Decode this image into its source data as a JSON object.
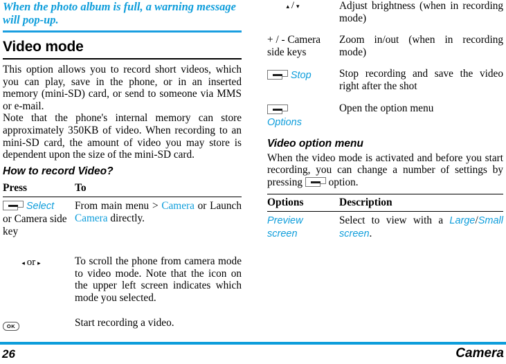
{
  "left_column": {
    "callout_note": "When the photo album is full, a warning message will pop-up.",
    "section_title": "Video mode",
    "paragraphs": [
      "This option allows you to record short videos, which you can play, save in the phone, or in an inserted memory (mini-SD) card, or send to someone via MMS or e-mail.",
      "Note that the phone's internal memory can store approximately 350KB of video. When recording to an mini-SD card, the amount of video you may store is dependent upon the size of the mini-SD card."
    ],
    "subhead": "How to record Video?",
    "table": {
      "headers": [
        "Press",
        "To"
      ],
      "rows": [
        {
          "press_icon": "softkey-icon",
          "press_icon_label": "Select",
          "press_text": "or Camera side key",
          "to_parts": [
            {
              "text": "From main menu > ",
              "style": "plain"
            },
            {
              "text": "Camera",
              "style": "blue"
            },
            {
              "text": " or Launch ",
              "style": "plain"
            },
            {
              "text": "Camera",
              "style": "blue"
            },
            {
              "text": " directly.",
              "style": "plain"
            }
          ]
        },
        {
          "press_icon": "left-right-arrows-icon",
          "press_left_arrow": "◂",
          "press_or": "or",
          "press_right_arrow": "▸",
          "to_parts": [
            {
              "text": "To scroll the phone from camera mode to video mode. Note that the icon on the upper left screen indicates which mode you selected.",
              "style": "plain"
            }
          ]
        },
        {
          "press_icon": "ok-key-icon",
          "press_icon_label": "OK",
          "to_parts": [
            {
              "text": "Start recording a video.",
              "style": "plain"
            }
          ]
        }
      ]
    }
  },
  "right_column": {
    "table_continued": {
      "rows": [
        {
          "press_icon": "up-down-arrows-icon",
          "press_up_arrow": "▴",
          "press_sep": "/",
          "press_down_arrow": "▾",
          "to_text": "Adjust brightness (when in recording mode)"
        },
        {
          "press_text": "+ / - Camera side keys",
          "to_text": "Zoom in/out (when in recording mode)"
        },
        {
          "press_icon": "softkey-icon",
          "press_icon_label": "Stop",
          "to_text": "Stop recording and save the video right after the shot"
        },
        {
          "press_icon": "softkey-icon",
          "press_icon_label_below": "Options",
          "to_text": "Open the option menu"
        }
      ]
    },
    "subhead": "Video option menu",
    "intro_before_key": "When the video mode is activated and before you start recording, you can change a number of settings by pressing",
    "intro_after_key": "option.",
    "options_table": {
      "headers": [
        "Options",
        "Description"
      ],
      "rows": [
        {
          "option": "Preview screen",
          "desc_parts": [
            {
              "text": "Select to view with a ",
              "style": "plain"
            },
            {
              "text": "Large",
              "style": "blue"
            },
            {
              "text": "/",
              "style": "plain"
            },
            {
              "text": "Small screen",
              "style": "blue"
            },
            {
              "text": ".",
              "style": "plain"
            }
          ]
        }
      ]
    }
  },
  "footer": {
    "page_number": "26",
    "running_head": "Camera"
  },
  "colors": {
    "accent_blue": "#0d9ddb",
    "rule_blue": "#1a9ee0",
    "text_black": "#000000"
  }
}
